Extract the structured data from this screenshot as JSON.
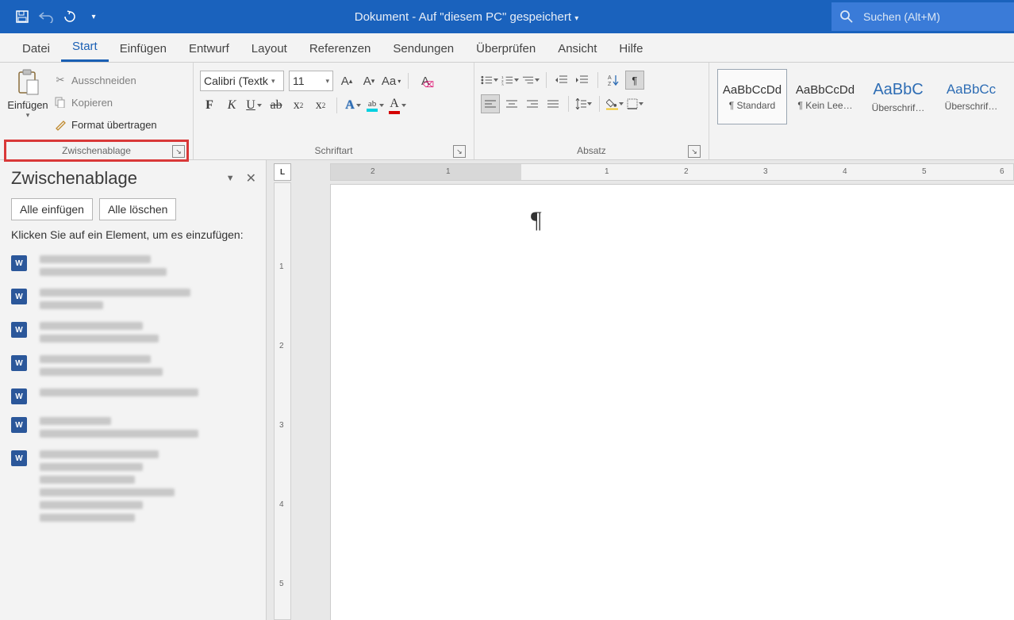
{
  "titlebar": {
    "document_title": "Dokument  -  Auf \"diesem PC\" gespeichert",
    "search_placeholder": "Suchen (Alt+M)"
  },
  "tabs": [
    "Datei",
    "Start",
    "Einfügen",
    "Entwurf",
    "Layout",
    "Referenzen",
    "Sendungen",
    "Überprüfen",
    "Ansicht",
    "Hilfe"
  ],
  "active_tab_index": 1,
  "ribbon": {
    "clipboard": {
      "paste": "Einfügen",
      "cut": "Ausschneiden",
      "copy": "Kopieren",
      "format_painter": "Format übertragen",
      "group_label": "Zwischenablage"
    },
    "font": {
      "font_name": "Calibri (Textk",
      "font_size": "11",
      "group_label": "Schriftart"
    },
    "paragraph": {
      "group_label": "Absatz"
    },
    "styles": [
      {
        "sample": "AaBbCcDd",
        "label": "¶ Standard",
        "selected": true,
        "heading": false
      },
      {
        "sample": "AaBbCcDd",
        "label": "¶ Kein Lee…",
        "selected": false,
        "heading": false
      },
      {
        "sample": "AaBbC",
        "label": "Überschrif…",
        "selected": false,
        "heading": true
      },
      {
        "sample": "AaBbCc",
        "label": "Überschrif…",
        "selected": false,
        "heading": true
      }
    ]
  },
  "taskpane": {
    "title": "Zwischenablage",
    "paste_all": "Alle einfügen",
    "clear_all": "Alle löschen",
    "hint": "Klicken Sie auf ein Element, um es einzufügen:"
  },
  "ruler_h_labels": [
    "2",
    "1",
    "",
    "1",
    "2",
    "3",
    "4",
    "5",
    "6"
  ],
  "ruler_v_labels": [
    "1",
    "2",
    "3",
    "4",
    "5"
  ],
  "tabstop": "L"
}
